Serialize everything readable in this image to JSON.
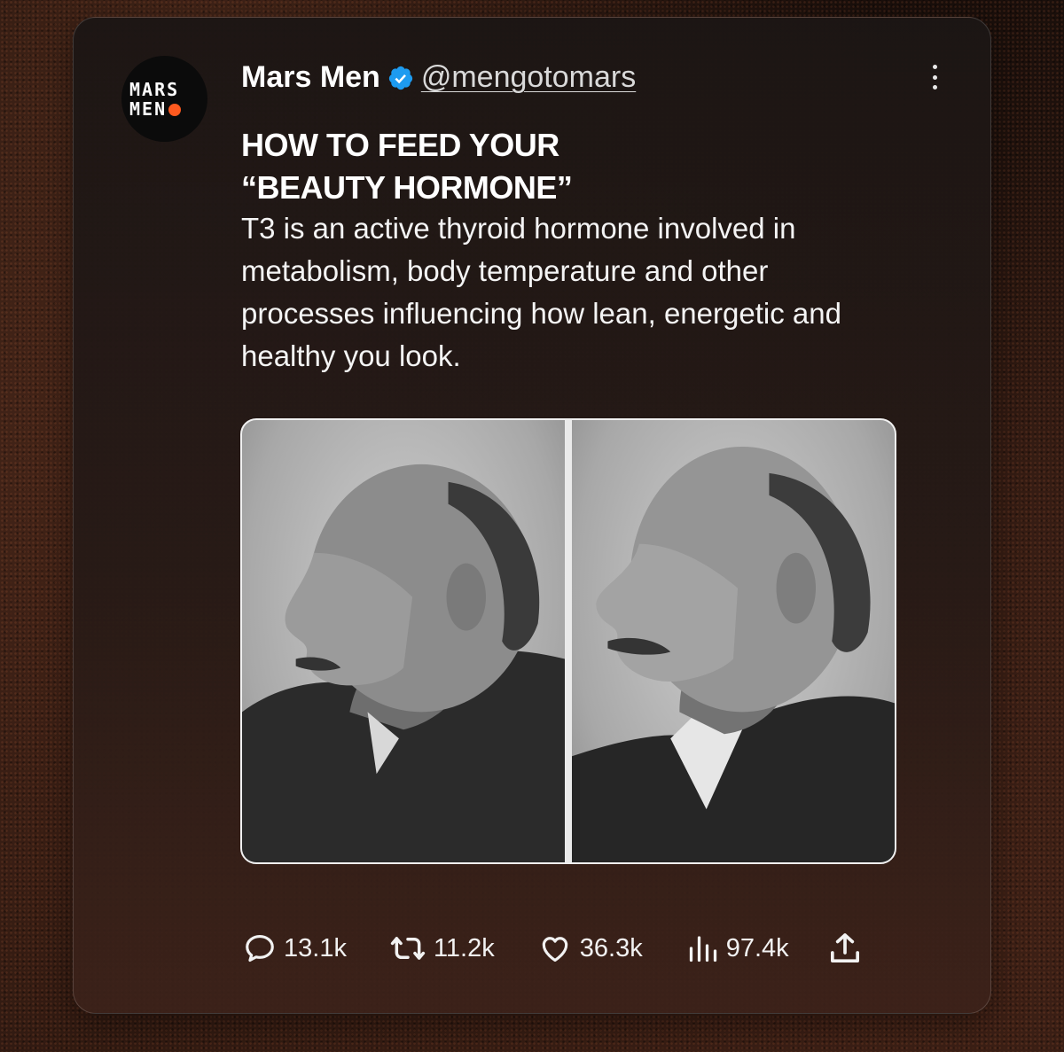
{
  "post": {
    "author_name": "Mars Men",
    "handle": "@mengotomars",
    "avatar_text_line1": "MARS",
    "avatar_text_line2": "MEN",
    "headline_line1": "HOW TO FEED YOUR",
    "headline_line2": "“BEAUTY HORMONE”",
    "body": "T3 is an active thyroid hormone involved in metabolism, body temperature and other processes influencing how lean, energetic and healthy you look."
  },
  "metrics": {
    "replies": "13.1k",
    "reposts": "11.2k",
    "likes": "36.3k",
    "views": "97.4k"
  },
  "icons": {
    "verified": "verified-badge-icon",
    "more": "more-vertical-icon",
    "reply": "reply-bubble-icon",
    "repost": "repost-icon",
    "like": "heart-icon",
    "views": "views-bars-icon",
    "share": "share-upload-icon"
  },
  "colors": {
    "verified_blue": "#1d9bf0",
    "avatar_dot": "#ff5a1f"
  }
}
